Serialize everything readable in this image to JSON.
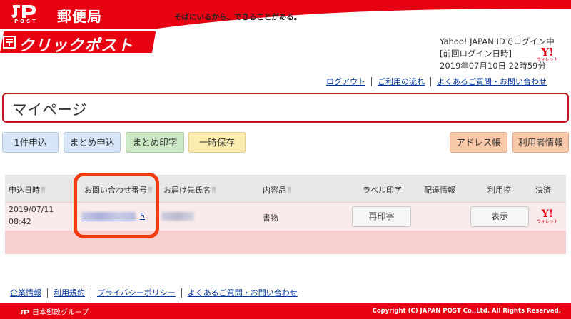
{
  "header": {
    "post_label": "POST",
    "yubinkyoku": "郵便局",
    "tagline": "そばにいるから、できることがある。",
    "brand": "クリックポスト"
  },
  "login": {
    "status": "Yahoo! JAPAN IDでログイン中",
    "last_login_label": "[前回ログイン日時]",
    "last_login_value": "2019年07月10日 22時59分"
  },
  "wallet": {
    "y": "Y!",
    "label": "ウォレット"
  },
  "top_links": [
    "ログアウト",
    "ご利用の流れ",
    "よくあるご質問・お問い合わせ"
  ],
  "page_title": "マイページ",
  "actions": {
    "single": "1件申込",
    "bulk": "まとめ申込",
    "bulk_print": "まとめ印字",
    "temp_save": "一時保存",
    "address_book": "アドレス帳",
    "user_info": "利用者情報"
  },
  "table": {
    "headers": {
      "date": "申込日時",
      "tracking": "お問い合わせ番号",
      "recipient": "お届け先氏名",
      "contents": "内容品",
      "label": "ラベル印字",
      "delivery": "配達情報",
      "receipt": "利用控",
      "payment": "決済"
    },
    "rows": [
      {
        "date": "2019/07/11",
        "time": "08:42",
        "tracking_tail": "5",
        "contents": "書物",
        "reprint": "再印字",
        "show": "表示"
      }
    ]
  },
  "footer": {
    "links": [
      "企業情報",
      "利用規約",
      "プライバシーポリシー",
      "よくあるご質問・お問い合わせ"
    ],
    "group": "日本郵政グループ",
    "copyright": "Copyright (C) JAPAN POST Co.,Ltd.  All Rights Reserved."
  },
  "colors": {
    "brand_red": "#e60012",
    "link_blue": "#003399",
    "highlight": "#f23b0f"
  }
}
